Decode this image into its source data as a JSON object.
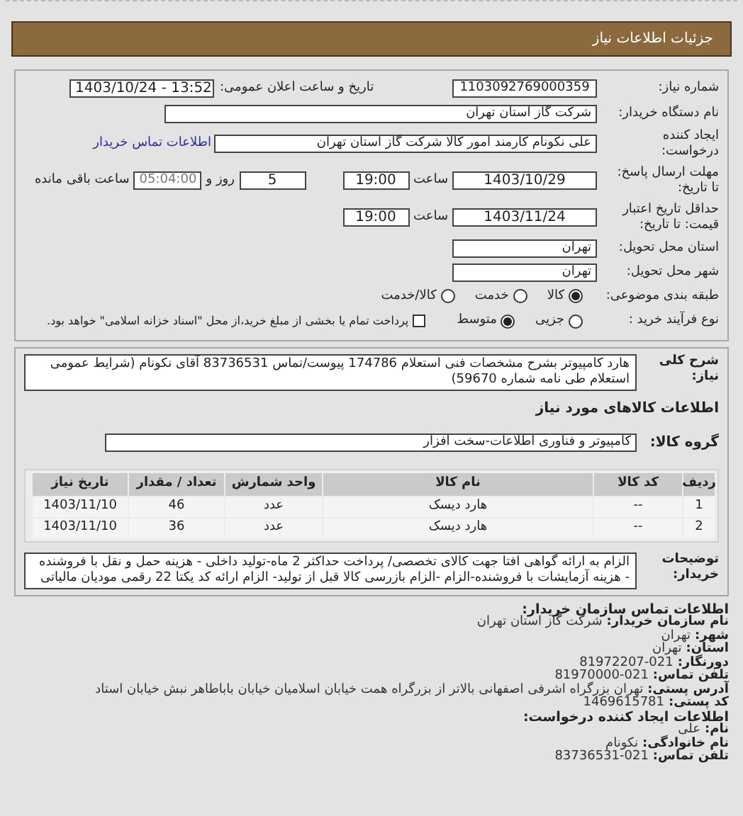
{
  "header": {
    "title": "جزئیات اطلاعات نیاز"
  },
  "need_number": {
    "label": "شماره نیاز:",
    "value": "1103092769000359"
  },
  "announce": {
    "label": "تاریخ و ساعت اعلان عمومی:",
    "value": "1403/10/24 - 13:52"
  },
  "buyer": {
    "label": "نام دستگاه خریدار:",
    "value": "شرکت گاز استان تهران"
  },
  "requester": {
    "label": "ایجاد کننده درخواست:",
    "value": "علی نکونام کارمند امور کالا شرکت گاز استان تهران",
    "link": "اطلاعات تماس خریدار"
  },
  "deadline": {
    "label": "مهلت ارسال پاسخ: تا تاریخ:",
    "date": "1403/10/29",
    "time_label": "ساعت",
    "time": "19:00",
    "days": "5",
    "days_label": "روز و",
    "remaining": "05:04:00",
    "remaining_label": "ساعت باقی مانده"
  },
  "validity": {
    "label": "حداقل تاریخ اعتبار قیمت: تا تاریخ:",
    "date": "1403/11/24",
    "time_label": "ساعت",
    "time": "19:00"
  },
  "province": {
    "label": "استان محل تحویل:",
    "value": "تهران"
  },
  "city": {
    "label": "شهر محل تحویل:",
    "value": "تهران"
  },
  "category": {
    "label": "طبقه بندی موضوعی:",
    "options": [
      {
        "label": "کالا",
        "selected": true
      },
      {
        "label": "خدمت",
        "selected": false
      },
      {
        "label": "کالا/خدمت",
        "selected": false
      }
    ]
  },
  "process": {
    "label": "نوع فرآیند خرید :",
    "options": [
      {
        "label": "جزیی",
        "selected": false
      },
      {
        "label": "متوسط",
        "selected": true
      }
    ],
    "payment": {
      "label": "پرداخت تمام یا بخشی از مبلغ خرید،از محل \"اسناد خزانه اسلامی\" خواهد بود.",
      "checked": false
    }
  },
  "description": {
    "label": "شرح کلی نیاز:",
    "text": "هارد کامپیوتر بشرح مشخصات فنی استعلام 174786 پیوست/تماس 83736531 آقای نکونام (شرایط عمومی استعلام طی نامه شماره 59670)"
  },
  "goods_title": "اطلاعات کالاهای مورد نیاز",
  "goods_group": {
    "label": "گروه کالا:",
    "value": "کامپیوتر و فناوری اطلاعات-سخت افزار"
  },
  "table": {
    "columns": [
      "ردیف",
      "کد کالا",
      "نام کالا",
      "واحد شمارش",
      "تعداد / مقدار",
      "تاریخ نیاز"
    ],
    "rows": [
      [
        "1",
        "--",
        "هارد دیسک",
        "عدد",
        "46",
        "1403/11/10"
      ],
      [
        "2",
        "--",
        "هارد دیسک",
        "عدد",
        "36",
        "1403/11/10"
      ]
    ]
  },
  "notes": {
    "label": "توضیحات خریدار:",
    "text": "الزام به ارائه گواهی افتا جهت کالای تخصصی/ پرداخت حداکثر 2 ماه-تولید داخلی - هزینه حمل و نقل با فروشنده - هزینه آزمایشات با فروشنده-الزام -الزام بازرسی کالا قبل از تولید- الزام ارائه کد یکتا 22 رقمی مودیان مالیاتی"
  },
  "contact": [
    {
      "kind": "heading",
      "label": "اطلاعات تماس سازمان خریدار:"
    },
    {
      "kind": "line",
      "label": "نام سازمان خریدار:",
      "value": "شرکت گاز استان تهران"
    },
    {
      "kind": "line",
      "label": "شهر:",
      "value": "تهران"
    },
    {
      "kind": "line",
      "label": "استان:",
      "value": "تهران"
    },
    {
      "kind": "number",
      "label": "دورنگار:",
      "value": "81972207-021"
    },
    {
      "kind": "number",
      "label": "تلفن تماس:",
      "value": "81970000-021"
    },
    {
      "kind": "line",
      "label": "آدرس پستی:",
      "value": "تهران بزرگراه اشرفی اصفهانی بالاتر از بزرگراه همت خیابان اسلامیان خیابان باباطاهر نبش خیابان استاد"
    },
    {
      "kind": "number",
      "label": "کد پستی:",
      "value": "1469615781"
    },
    {
      "kind": "heading",
      "label": "اطلاعات ایجاد کننده درخواست:"
    },
    {
      "kind": "line",
      "label": "نام:",
      "value": "علی"
    },
    {
      "kind": "line",
      "label": "نام خانوادگی:",
      "value": "نکونام"
    },
    {
      "kind": "number",
      "label": "تلفن تماس:",
      "value": "83736531-021"
    }
  ]
}
